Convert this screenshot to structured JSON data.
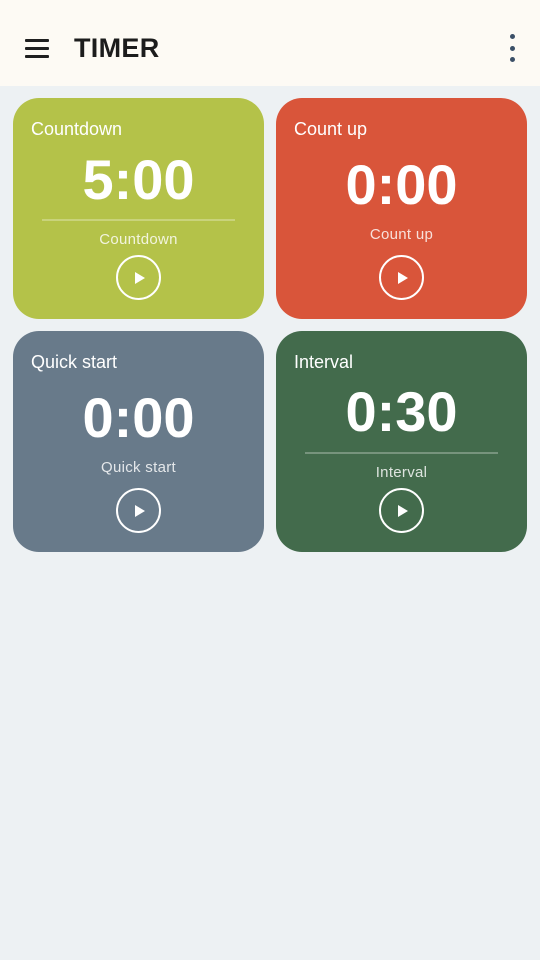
{
  "app_bar": {
    "title": "TIMER",
    "menu_icon": "hamburger-menu-icon",
    "overflow_icon": "more-vertical-icon"
  },
  "tiles": [
    {
      "name": "Countdown",
      "time": "5:00",
      "subtitle": "Countdown",
      "color": "#b4c249",
      "has_divider": true,
      "action_icon": "play-icon"
    },
    {
      "name": "Count up",
      "time": "0:00",
      "subtitle": "Count up",
      "color": "#d9553a",
      "has_divider": false,
      "action_icon": "play-icon"
    },
    {
      "name": "Quick start",
      "time": "0:00",
      "subtitle": "Quick start",
      "color": "#687a8a",
      "has_divider": false,
      "action_icon": "play-icon"
    },
    {
      "name": "Interval",
      "time": "0:30",
      "subtitle": "Interval",
      "color": "#436b4c",
      "has_divider": true,
      "action_icon": "play-icon"
    }
  ],
  "colors": {
    "app_bar_background": "#fdfaf4",
    "page_background": "#edf1f3"
  }
}
